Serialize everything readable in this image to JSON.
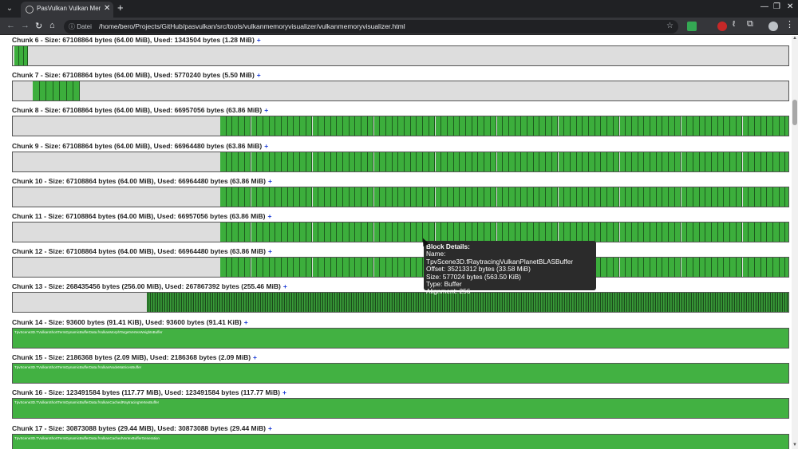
{
  "browser": {
    "tab_title": "PasVulkan Vulkan Memor",
    "file_chip": "Datei",
    "url": "/home/bero/Projects/GitHub/pasvulkan/src/tools/vulkanmemoryvisualizer/vulkanmemoryvisualizer.html"
  },
  "chunks": [
    {
      "header": "Chunk 6 - Size: 67108864 bytes (64.00 MiB), Used: 1343504 bytes (1.28 MiB)",
      "plus": "+"
    },
    {
      "header": "Chunk 7 - Size: 67108864 bytes (64.00 MiB), Used: 5770240 bytes (5.50 MiB)",
      "plus": "+"
    },
    {
      "header": "Chunk 8 - Size: 67108864 bytes (64.00 MiB), Used: 66957056 bytes (63.86 MiB)",
      "plus": "+"
    },
    {
      "header": "Chunk 9 - Size: 67108864 bytes (64.00 MiB), Used: 66964480 bytes (63.86 MiB)",
      "plus": "+"
    },
    {
      "header": "Chunk 10 - Size: 67108864 bytes (64.00 MiB), Used: 66964480 bytes (63.86 MiB)",
      "plus": "+"
    },
    {
      "header": "Chunk 11 - Size: 67108864 bytes (64.00 MiB), Used: 66957056 bytes (63.86 MiB)",
      "plus": "+"
    },
    {
      "header": "Chunk 12 - Size: 67108864 bytes (64.00 MiB), Used: 66964480 bytes (63.86 MiB)",
      "plus": "+"
    },
    {
      "header": "Chunk 13 - Size: 268435456 bytes (256.00 MiB), Used: 267867392 bytes (255.46 MiB)",
      "plus": "+"
    },
    {
      "header": "Chunk 14 - Size: 93600 bytes (91.41 KiB), Used: 93600 bytes (91.41 KiB)",
      "plus": "+",
      "block_label": "TpvScene3D.TVulkanShortTermDynamicBufferData.fVulkanMorphTargetVertexWeightsBuffer"
    },
    {
      "header": "Chunk 15 - Size: 2186368 bytes (2.09 MiB), Used: 2186368 bytes (2.09 MiB)",
      "plus": "+",
      "block_label": "TpvScene3D.TVulkanShortTermDynamicBufferData.fVulkanNodeMatricesBuffer"
    },
    {
      "header": "Chunk 16 - Size: 123491584 bytes (117.77 MiB), Used: 123491584 bytes (117.77 MiB)",
      "plus": "+",
      "block_label": "TpvScene3D.TVulkanShortTermDynamicBufferData.fVulkanCachedRaytracingVertexBuffer"
    },
    {
      "header": "Chunk 17 - Size: 30873088 bytes (29.44 MiB), Used: 30873088 bytes (29.44 MiB)",
      "plus": "+",
      "block_label": "TpvScene3D.TVulkanShortTermDynamicBufferData.fVulkanCachedVertexBufferGeneration"
    }
  ],
  "tooltip": {
    "title": "Block Details:",
    "name": "Name: TpvScene3D.fRaytracingVulkanPlanetBLASBuffer",
    "offset": "Offset: 35213312 bytes (33.58 MiB)",
    "size": "Size: 577024 bytes (563.50 KiB)",
    "type": "Type: Buffer",
    "alignment": "Alignment: 256"
  },
  "colors": {
    "used_block": "#3cae3c",
    "free_space": "#dddddd",
    "tooltip_bg": "#2b2b2b",
    "plus_link": "#1a3bd6"
  },
  "icons": [
    "tab-list-icon",
    "close-icon",
    "new-tab-icon",
    "minimize-icon",
    "maximize-icon",
    "window-close-icon",
    "back-icon",
    "forward-icon",
    "reload-icon",
    "home-icon",
    "info-icon",
    "star-icon",
    "extension-icon",
    "profile-icon",
    "menu-icon"
  ]
}
